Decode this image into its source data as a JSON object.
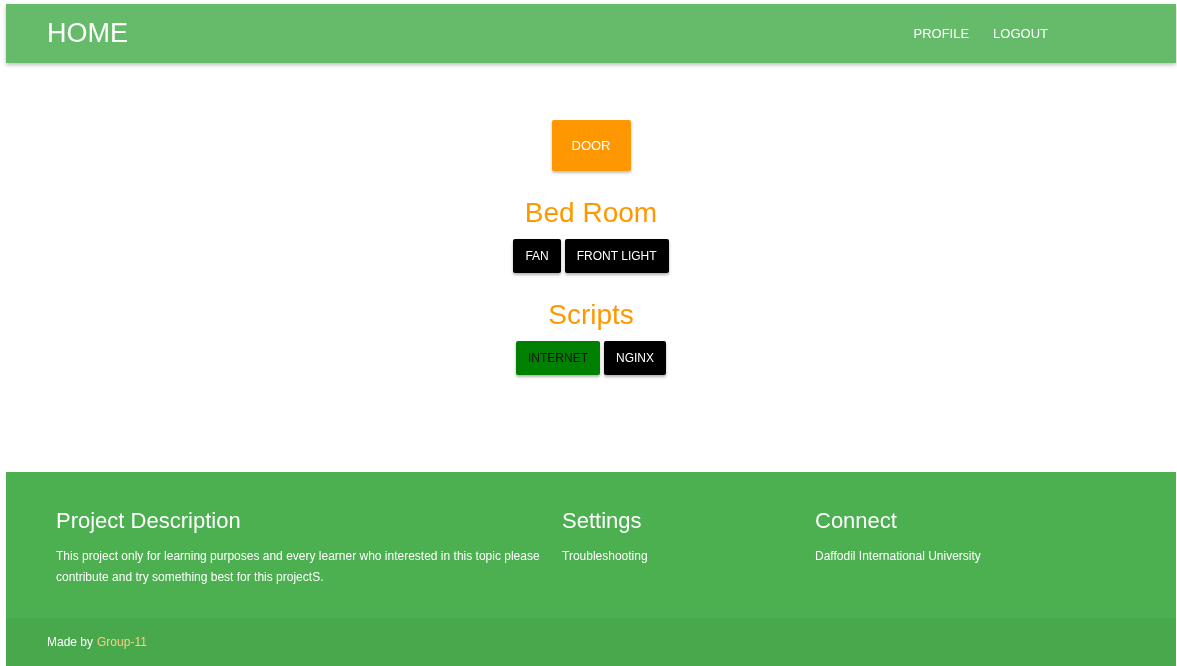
{
  "navbar": {
    "brand": "HOME",
    "links": [
      "PROFILE",
      "LOGOUT"
    ]
  },
  "door": {
    "label": "DOOR"
  },
  "sections": [
    {
      "title": "Bed Room",
      "buttons": [
        {
          "label": "FAN",
          "on": false
        },
        {
          "label": "FRONT LIGHT",
          "on": false
        }
      ]
    },
    {
      "title": "Scripts",
      "buttons": [
        {
          "label": "INTERNET",
          "on": true
        },
        {
          "label": "NGINX",
          "on": false
        }
      ]
    }
  ],
  "footer": {
    "columns": [
      {
        "title": "Project Description",
        "text": "This project only for learning purposes and every learner who interested in this topic please contribute and try something best for this projectS."
      },
      {
        "title": "Settings",
        "links": [
          "Troubleshooting"
        ]
      },
      {
        "title": "Connect",
        "links": [
          "Daffodil International University"
        ]
      }
    ],
    "copyright": {
      "prefix": "Made by",
      "link": "Group-11"
    }
  }
}
